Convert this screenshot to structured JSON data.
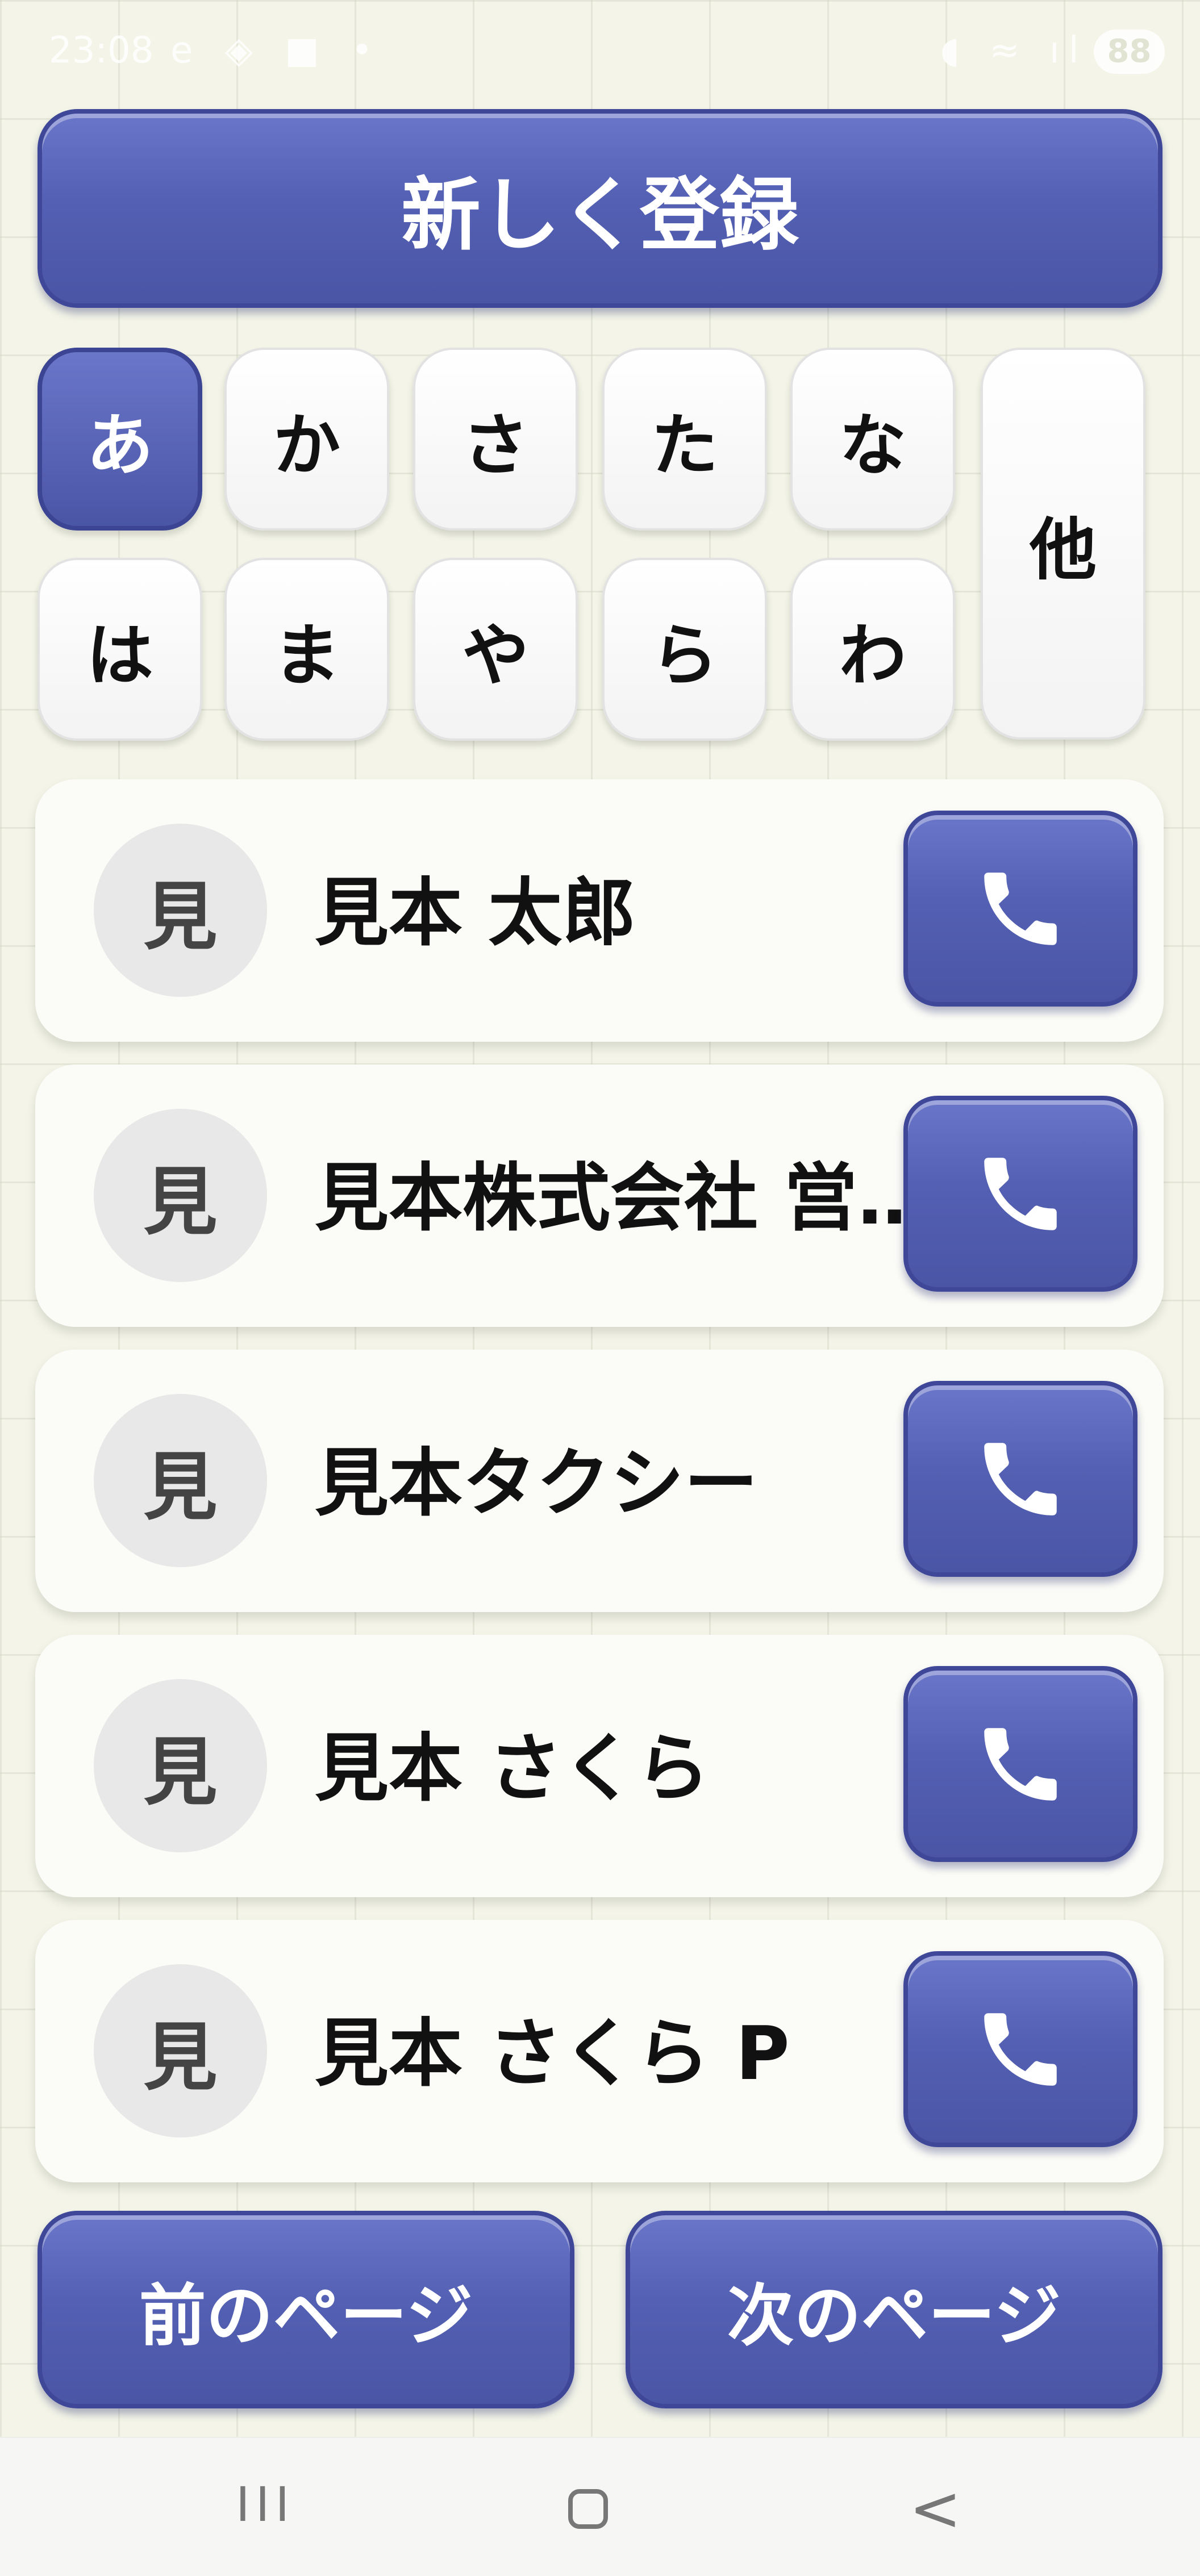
{
  "status_bar": {
    "time": "23:08",
    "left_icons": "e ◈ ■ •",
    "right_icons": "◖ ≈ ıl",
    "battery": "88"
  },
  "register_label": "新しく登録",
  "kana_row1": [
    "あ",
    "か",
    "さ",
    "た",
    "な"
  ],
  "kana_row2": [
    "は",
    "ま",
    "や",
    "ら",
    "わ"
  ],
  "kana_other": "他",
  "contacts": [
    {
      "initial": "見",
      "name": "見本 太郎"
    },
    {
      "initial": "見",
      "name": "見本株式会社 営…"
    },
    {
      "initial": "見",
      "name": "見本タクシー"
    },
    {
      "initial": "見",
      "name": "見本 さくら"
    },
    {
      "initial": "見",
      "name": "見本 さくら P"
    }
  ],
  "prev_page": "前のページ",
  "next_page": "次のページ",
  "nav": {
    "recents": "III",
    "back": "<"
  },
  "icons": {
    "call": "phone-icon",
    "home": "home-icon",
    "recents": "recents-icon",
    "back": "back-icon"
  },
  "colors": {
    "accent": "#5460b3",
    "background": "#f4f5e8"
  }
}
